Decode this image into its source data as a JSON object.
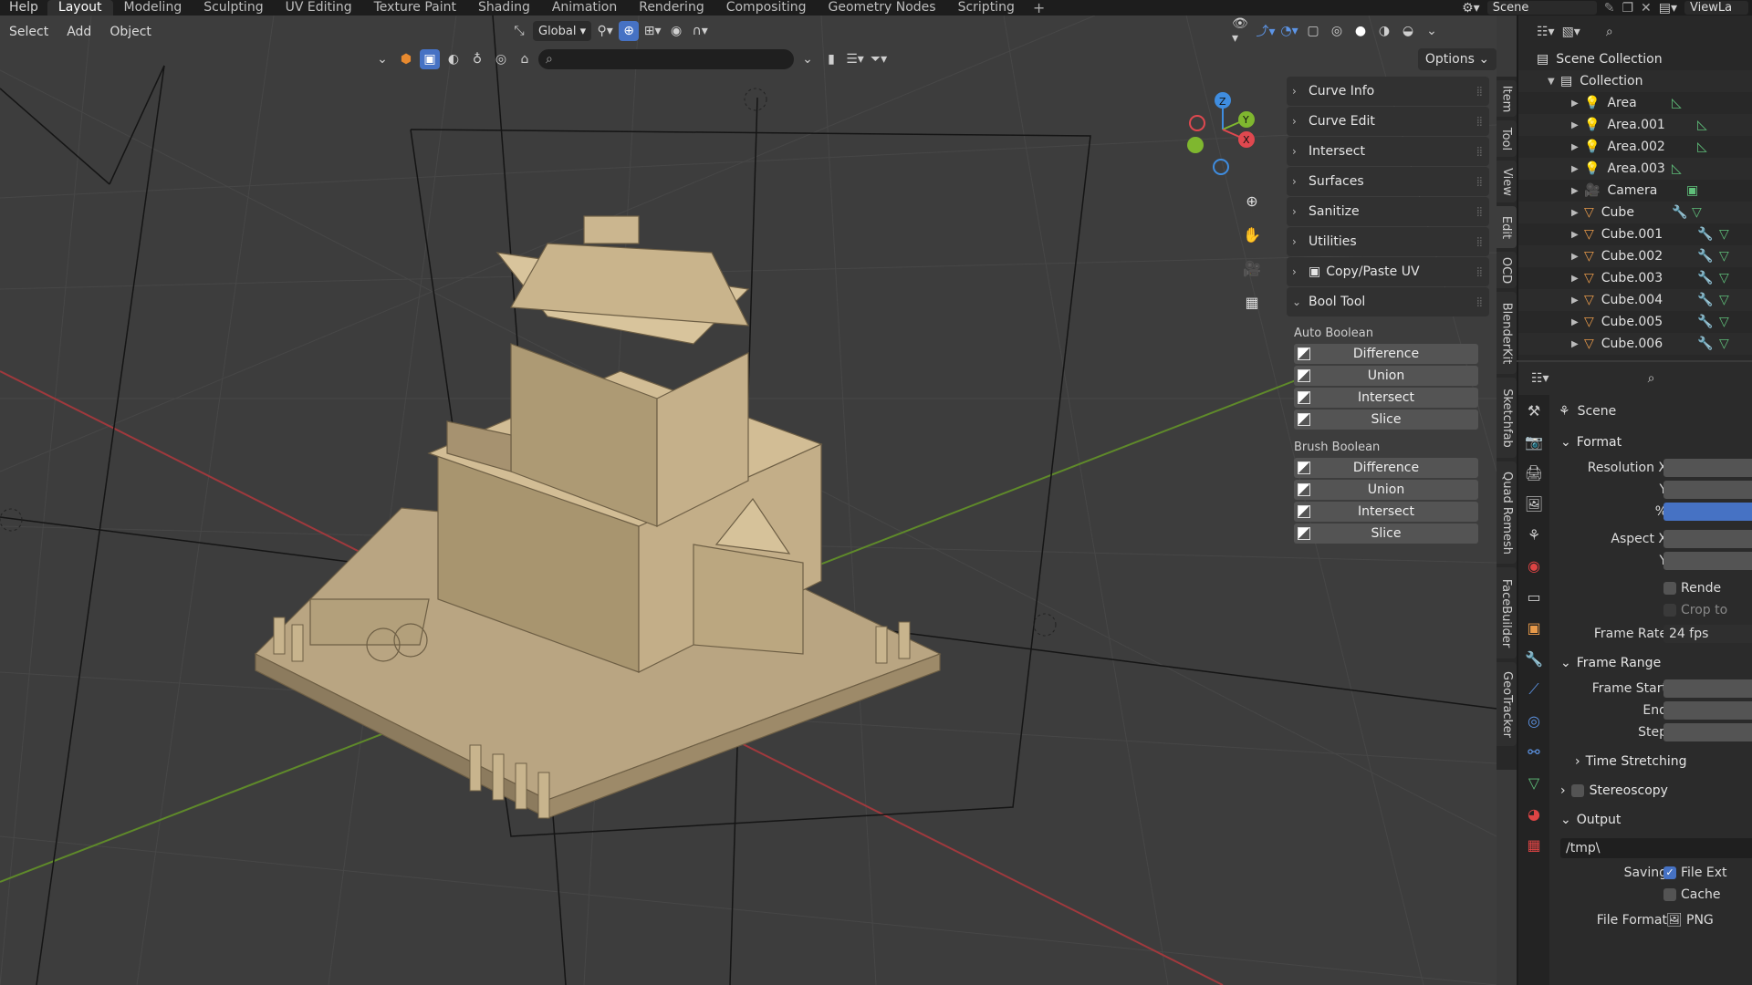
{
  "topbar": {
    "menus": [
      "Help"
    ],
    "workspaces": [
      "Layout",
      "Modeling",
      "Sculpting",
      "UV Editing",
      "Texture Paint",
      "Shading",
      "Animation",
      "Rendering",
      "Compositing",
      "Geometry Nodes",
      "Scripting"
    ],
    "plus": "+",
    "scene": "Scene",
    "view_layer": "ViewLa"
  },
  "header": {
    "menus": [
      "Select",
      "Add",
      "Object"
    ],
    "transform_orientation": "Global",
    "options_label": "Options"
  },
  "npanel": {
    "panels": [
      {
        "label": "Curve Info"
      },
      {
        "label": "Curve Edit"
      },
      {
        "label": "Intersect"
      },
      {
        "label": "Surfaces"
      },
      {
        "label": "Sanitize"
      },
      {
        "label": "Utilities"
      },
      {
        "label": "Copy/Paste UV"
      }
    ],
    "bool_tool": {
      "label": "Bool Tool",
      "auto_label": "Auto Boolean",
      "auto_buttons": [
        "Difference",
        "Union",
        "Intersect",
        "Slice"
      ],
      "brush_label": "Brush Boolean",
      "brush_buttons": [
        "Difference",
        "Union",
        "Intersect",
        "Slice"
      ]
    }
  },
  "sidetabs": [
    "Item",
    "Tool",
    "View",
    "Edit",
    "OCD",
    "BlenderKit",
    "Sketchfab",
    "Quad Remesh",
    "FaceBuilder",
    "GeoTracker"
  ],
  "outliner": {
    "scene_collection": "Scene Collection",
    "collection": "Collection",
    "items": [
      {
        "name": "Area",
        "type": "light"
      },
      {
        "name": "Area.001",
        "type": "light"
      },
      {
        "name": "Area.002",
        "type": "light"
      },
      {
        "name": "Area.003",
        "type": "light"
      },
      {
        "name": "Camera",
        "type": "camera"
      },
      {
        "name": "Cube",
        "type": "mesh"
      },
      {
        "name": "Cube.001",
        "type": "mesh"
      },
      {
        "name": "Cube.002",
        "type": "mesh"
      },
      {
        "name": "Cube.003",
        "type": "mesh"
      },
      {
        "name": "Cube.004",
        "type": "mesh"
      },
      {
        "name": "Cube.005",
        "type": "mesh"
      },
      {
        "name": "Cube.006",
        "type": "mesh"
      }
    ]
  },
  "properties": {
    "context": "Scene",
    "format": {
      "title": "Format",
      "resolution_x": "Resolution X",
      "y": "Y",
      "percent": "%",
      "aspect_x": "Aspect X",
      "aspect_y": "Y",
      "render_region": "Rende",
      "crop": "Crop to",
      "frame_rate_label": "Frame Rate",
      "frame_rate_value": "24 fps"
    },
    "frame_range": {
      "title": "Frame Range",
      "start": "Frame Start",
      "end": "End",
      "step": "Step"
    },
    "time_stretching": "Time Stretching",
    "stereoscopy": "Stereoscopy",
    "output": {
      "title": "Output",
      "path": "/tmp\\",
      "saving_label": "Saving",
      "file_ext": "File Ext",
      "cache": "Cache",
      "file_format_label": "File Format",
      "file_format_value": "PNG"
    }
  },
  "gizmo": {
    "x": "X",
    "y": "Y",
    "z": "Z"
  },
  "colors": {
    "accent": "#4672c4",
    "x_axis": "#e0484f",
    "y_axis": "#7fb72f",
    "z_axis": "#3f8de0",
    "model": "#b9a582"
  }
}
